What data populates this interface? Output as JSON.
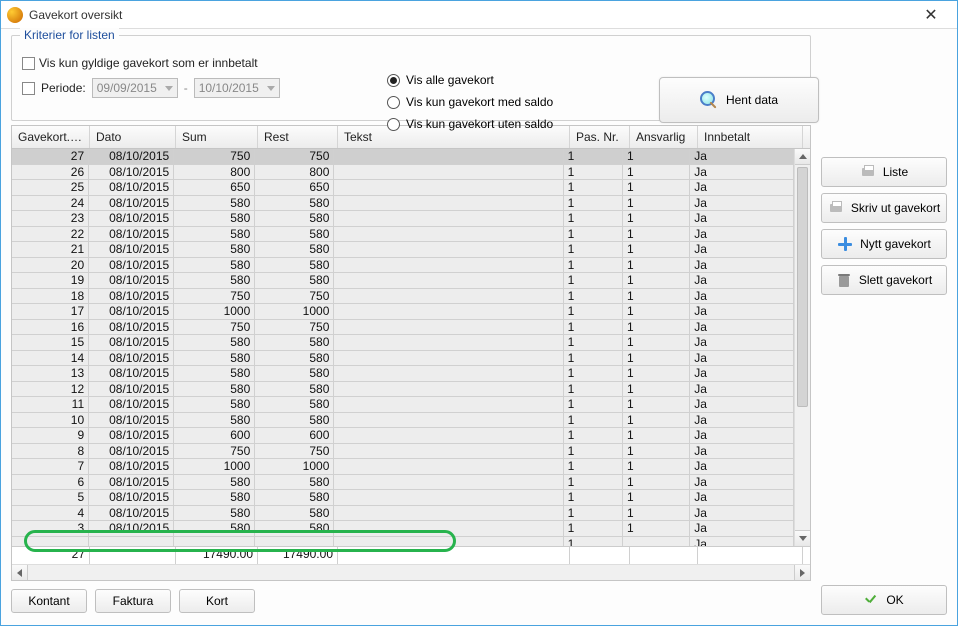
{
  "window": {
    "title": "Gavekort oversikt"
  },
  "criteria": {
    "legend": "Kriterier for listen",
    "show_valid_paid_label": "Vis kun gyldige gavekort som er innbetalt",
    "period_label": "Periode:",
    "period_from": "09/09/2015",
    "period_to": "10/10/2015",
    "period_sep": "-"
  },
  "radios": {
    "all": "Vis alle gavekort",
    "with_balance": "Vis kun gavekort med saldo",
    "without_balance": "Vis kun gavekort uten saldo"
  },
  "buttons": {
    "hent_data": "Hent data",
    "liste": "Liste",
    "skriv_ut": "Skriv ut gavekort",
    "nytt": "Nytt gavekort",
    "slett": "Slett gavekort",
    "kontant": "Kontant",
    "faktura": "Faktura",
    "kort": "Kort",
    "ok": "OK"
  },
  "grid": {
    "headers": {
      "nr": "Gavekort. Nr.",
      "dato": "Dato",
      "sum": "Sum",
      "rest": "Rest",
      "tekst": "Tekst",
      "pasnr": "Pas. Nr.",
      "ansvarlig": "Ansvarlig",
      "innbetalt": "Innbetalt"
    },
    "rows": [
      {
        "nr": "27",
        "dato": "08/10/2015",
        "sum": "750",
        "rest": "750",
        "tekst": "",
        "pasnr": "1",
        "ansvarlig": "1",
        "innbetalt": "Ja"
      },
      {
        "nr": "26",
        "dato": "08/10/2015",
        "sum": "800",
        "rest": "800",
        "tekst": "",
        "pasnr": "1",
        "ansvarlig": "1",
        "innbetalt": "Ja"
      },
      {
        "nr": "25",
        "dato": "08/10/2015",
        "sum": "650",
        "rest": "650",
        "tekst": "",
        "pasnr": "1",
        "ansvarlig": "1",
        "innbetalt": "Ja"
      },
      {
        "nr": "24",
        "dato": "08/10/2015",
        "sum": "580",
        "rest": "580",
        "tekst": "",
        "pasnr": "1",
        "ansvarlig": "1",
        "innbetalt": "Ja"
      },
      {
        "nr": "23",
        "dato": "08/10/2015",
        "sum": "580",
        "rest": "580",
        "tekst": "",
        "pasnr": "1",
        "ansvarlig": "1",
        "innbetalt": "Ja"
      },
      {
        "nr": "22",
        "dato": "08/10/2015",
        "sum": "580",
        "rest": "580",
        "tekst": "",
        "pasnr": "1",
        "ansvarlig": "1",
        "innbetalt": "Ja"
      },
      {
        "nr": "21",
        "dato": "08/10/2015",
        "sum": "580",
        "rest": "580",
        "tekst": "",
        "pasnr": "1",
        "ansvarlig": "1",
        "innbetalt": "Ja"
      },
      {
        "nr": "20",
        "dato": "08/10/2015",
        "sum": "580",
        "rest": "580",
        "tekst": "",
        "pasnr": "1",
        "ansvarlig": "1",
        "innbetalt": "Ja"
      },
      {
        "nr": "19",
        "dato": "08/10/2015",
        "sum": "580",
        "rest": "580",
        "tekst": "",
        "pasnr": "1",
        "ansvarlig": "1",
        "innbetalt": "Ja"
      },
      {
        "nr": "18",
        "dato": "08/10/2015",
        "sum": "750",
        "rest": "750",
        "tekst": "",
        "pasnr": "1",
        "ansvarlig": "1",
        "innbetalt": "Ja"
      },
      {
        "nr": "17",
        "dato": "08/10/2015",
        "sum": "1000",
        "rest": "1000",
        "tekst": "",
        "pasnr": "1",
        "ansvarlig": "1",
        "innbetalt": "Ja"
      },
      {
        "nr": "16",
        "dato": "08/10/2015",
        "sum": "750",
        "rest": "750",
        "tekst": "",
        "pasnr": "1",
        "ansvarlig": "1",
        "innbetalt": "Ja"
      },
      {
        "nr": "15",
        "dato": "08/10/2015",
        "sum": "580",
        "rest": "580",
        "tekst": "",
        "pasnr": "1",
        "ansvarlig": "1",
        "innbetalt": "Ja"
      },
      {
        "nr": "14",
        "dato": "08/10/2015",
        "sum": "580",
        "rest": "580",
        "tekst": "",
        "pasnr": "1",
        "ansvarlig": "1",
        "innbetalt": "Ja"
      },
      {
        "nr": "13",
        "dato": "08/10/2015",
        "sum": "580",
        "rest": "580",
        "tekst": "",
        "pasnr": "1",
        "ansvarlig": "1",
        "innbetalt": "Ja"
      },
      {
        "nr": "12",
        "dato": "08/10/2015",
        "sum": "580",
        "rest": "580",
        "tekst": "",
        "pasnr": "1",
        "ansvarlig": "1",
        "innbetalt": "Ja"
      },
      {
        "nr": "11",
        "dato": "08/10/2015",
        "sum": "580",
        "rest": "580",
        "tekst": "",
        "pasnr": "1",
        "ansvarlig": "1",
        "innbetalt": "Ja"
      },
      {
        "nr": "10",
        "dato": "08/10/2015",
        "sum": "580",
        "rest": "580",
        "tekst": "",
        "pasnr": "1",
        "ansvarlig": "1",
        "innbetalt": "Ja"
      },
      {
        "nr": "9",
        "dato": "08/10/2015",
        "sum": "600",
        "rest": "600",
        "tekst": "",
        "pasnr": "1",
        "ansvarlig": "1",
        "innbetalt": "Ja"
      },
      {
        "nr": "8",
        "dato": "08/10/2015",
        "sum": "750",
        "rest": "750",
        "tekst": "",
        "pasnr": "1",
        "ansvarlig": "1",
        "innbetalt": "Ja"
      },
      {
        "nr": "7",
        "dato": "08/10/2015",
        "sum": "1000",
        "rest": "1000",
        "tekst": "",
        "pasnr": "1",
        "ansvarlig": "1",
        "innbetalt": "Ja"
      },
      {
        "nr": "6",
        "dato": "08/10/2015",
        "sum": "580",
        "rest": "580",
        "tekst": "",
        "pasnr": "1",
        "ansvarlig": "1",
        "innbetalt": "Ja"
      },
      {
        "nr": "5",
        "dato": "08/10/2015",
        "sum": "580",
        "rest": "580",
        "tekst": "",
        "pasnr": "1",
        "ansvarlig": "1",
        "innbetalt": "Ja"
      },
      {
        "nr": "4",
        "dato": "08/10/2015",
        "sum": "580",
        "rest": "580",
        "tekst": "",
        "pasnr": "1",
        "ansvarlig": "1",
        "innbetalt": "Ja"
      },
      {
        "nr": "3",
        "dato": "08/10/2015",
        "sum": "580",
        "rest": "580",
        "tekst": "",
        "pasnr": "1",
        "ansvarlig": "1",
        "innbetalt": "Ja"
      },
      {
        "nr": "",
        "dato": "",
        "sum": "",
        "rest": "",
        "tekst": "",
        "pasnr": "1",
        "ansvarlig": "",
        "innbetalt": "Ja"
      }
    ],
    "totals": {
      "count": "27",
      "sum": "17490.00",
      "rest": "17490.00"
    }
  }
}
